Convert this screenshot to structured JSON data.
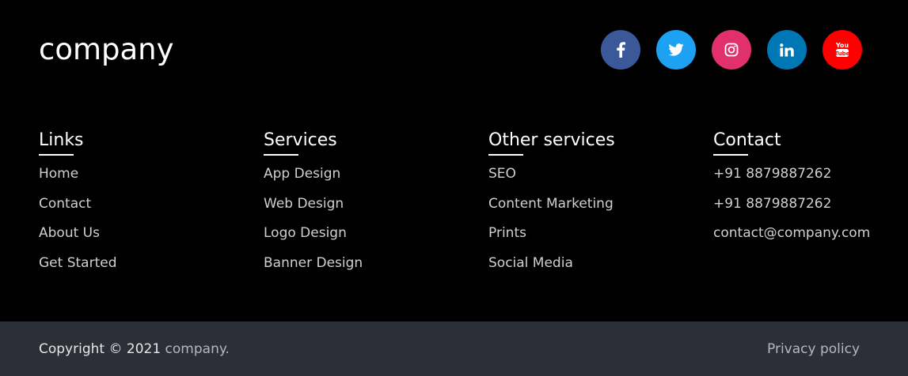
{
  "brand": "company",
  "social": [
    {
      "name": "facebook",
      "icon": "facebook-icon",
      "color": "#3b5998"
    },
    {
      "name": "twitter",
      "icon": "twitter-icon",
      "color": "#1da1f2"
    },
    {
      "name": "instagram",
      "icon": "instagram-icon",
      "color": "#e1306c"
    },
    {
      "name": "linkedin",
      "icon": "linkedin-icon",
      "color": "#0077b5"
    },
    {
      "name": "youtube",
      "icon": "youtube-icon",
      "color": "#ff0000"
    }
  ],
  "columns": [
    {
      "title": "Links",
      "items": [
        "Home",
        "Contact",
        "About Us",
        "Get Started"
      ]
    },
    {
      "title": "Services",
      "items": [
        "App Design",
        "Web Design",
        "Logo Design",
        "Banner Design"
      ]
    },
    {
      "title": "Other services",
      "items": [
        "SEO",
        "Content Marketing",
        "Prints",
        "Social Media"
      ]
    },
    {
      "title": "Contact",
      "items": [
        "+91 8879887262",
        "+91 8879887262",
        "contact@company.com"
      ]
    }
  ],
  "footer": {
    "copyright_prefix": "Copyright © 2021 ",
    "copyright_brand": "company.",
    "privacy": "Privacy policy"
  },
  "colors": {
    "background": "#000000",
    "bottom_bar": "#2c2f38"
  }
}
